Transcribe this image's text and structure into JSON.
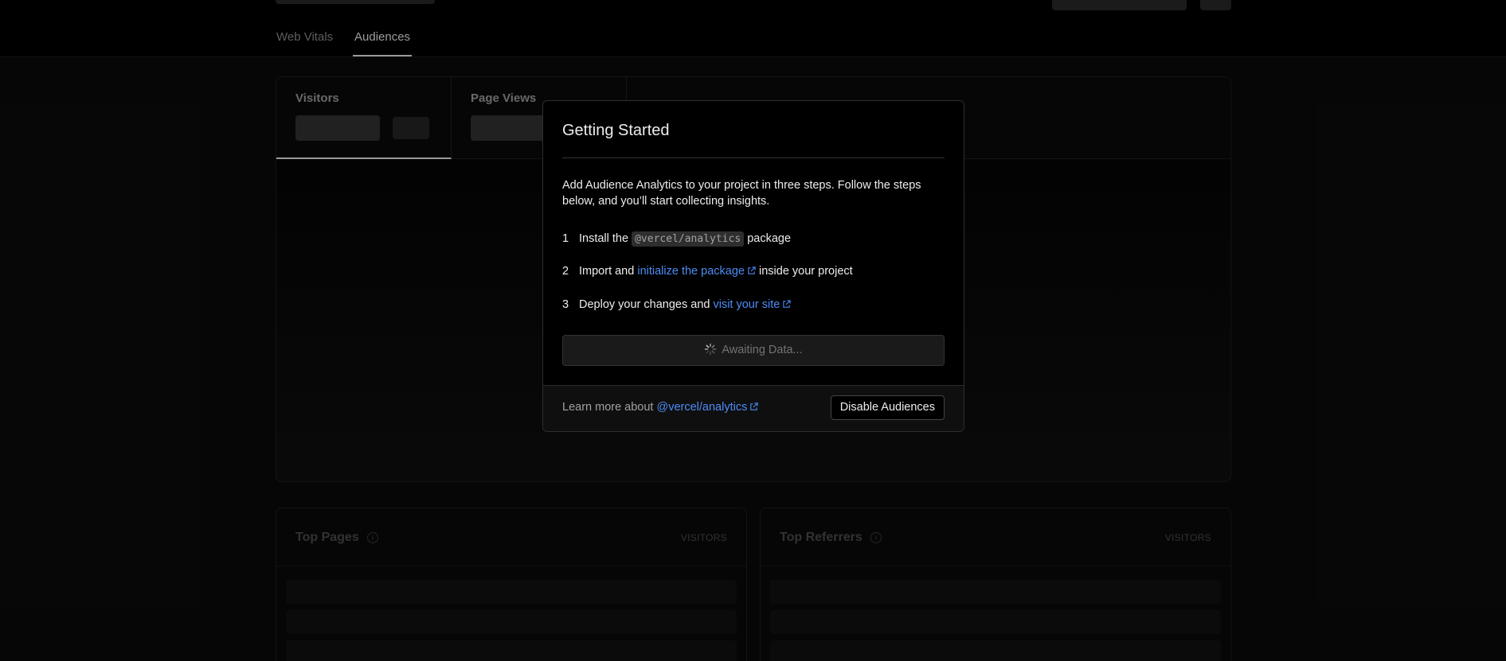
{
  "nav": {
    "tabs": [
      {
        "label": "Web Vitals",
        "active": false
      },
      {
        "label": "Audiences",
        "active": true
      }
    ]
  },
  "chart": {
    "metrics": [
      {
        "label": "Visitors",
        "active": true
      },
      {
        "label": "Page Views",
        "active": false
      }
    ]
  },
  "panels": {
    "top_pages": {
      "title": "Top Pages",
      "column": "VISITORS"
    },
    "top_referrers": {
      "title": "Top Referrers",
      "column": "VISITORS"
    }
  },
  "modal": {
    "title": "Getting Started",
    "intro": "Add Audience Analytics to your project in three steps. Follow the steps below, and you’ll start collecting insights.",
    "steps": [
      {
        "num": "1",
        "pre": "Install the",
        "code": "@vercel/analytics",
        "post": "package"
      },
      {
        "num": "2",
        "pre": "Import and",
        "link": "initialize the package",
        "post": "inside your project"
      },
      {
        "num": "3",
        "pre": "Deploy your changes and",
        "link": "visit your site",
        "post": ""
      }
    ],
    "status": "Awaiting Data...",
    "footer": {
      "learn_more": "Learn more about",
      "learn_link": "@vercel/analytics",
      "disable_button": "Disable Audiences"
    }
  },
  "colors": {
    "link": "#4d8cf5",
    "background": "#000000"
  },
  "icons": [
    "external-link-icon",
    "spinner-icon",
    "info-icon"
  ]
}
